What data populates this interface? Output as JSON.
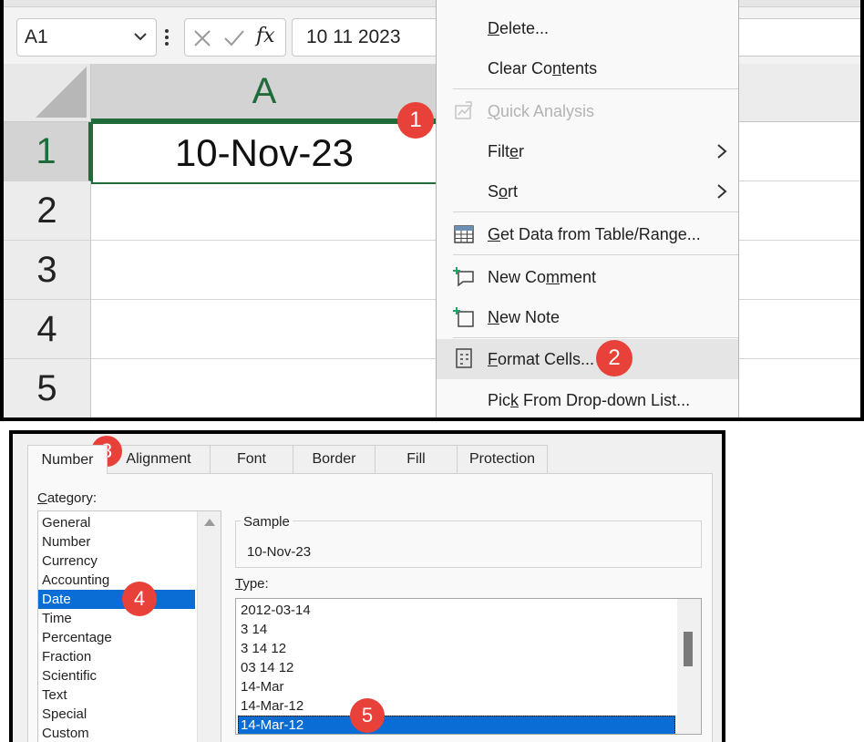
{
  "formula_bar": {
    "name_box": "A1",
    "formula_value": "10 11 2023"
  },
  "sheet": {
    "column_header": "A",
    "row_headers": [
      "1",
      "2",
      "3",
      "4",
      "5"
    ],
    "cell_a1": "10-Nov-23"
  },
  "context_menu": {
    "items": [
      {
        "label": "Delete...",
        "u": "D",
        "pre": "",
        "post": "elete..."
      },
      {
        "label": "Clear Contents",
        "pre": "Clear Co",
        "u": "n",
        "post": "tents"
      },
      {
        "label": "Quick Analysis",
        "pre": "",
        "u": "Q",
        "post": "uick Analysis"
      },
      {
        "label": "Filter",
        "pre": "Filt",
        "u": "e",
        "post": "r"
      },
      {
        "label": "Sort",
        "pre": "S",
        "u": "o",
        "post": "rt"
      },
      {
        "label": "Get Data from Table/Range...",
        "pre": "",
        "u": "G",
        "post": "et Data from Table/Range..."
      },
      {
        "label": "New Comment",
        "pre": "New Co",
        "u": "m",
        "post": "ment"
      },
      {
        "label": "New Note",
        "pre": "",
        "u": "N",
        "post": "ew Note"
      },
      {
        "label": "Format Cells...",
        "pre": "",
        "u": "F",
        "post": "ormat Cells..."
      },
      {
        "label": "Pick From Drop-down List...",
        "pre": "Pic",
        "u": "k",
        "post": " From Drop-down List..."
      }
    ]
  },
  "steps": [
    "1",
    "2",
    "3",
    "4",
    "5"
  ],
  "dialog": {
    "tabs": [
      "Number",
      "Alignment",
      "Font",
      "Border",
      "Fill",
      "Protection"
    ],
    "category_label": "Category:",
    "category_label_u": "C",
    "category_label_rest": "ategory:",
    "categories": [
      "General",
      "Number",
      "Currency",
      "Accounting",
      "Date",
      "Time",
      "Percentage",
      "Fraction",
      "Scientific",
      "Text",
      "Special",
      "Custom"
    ],
    "selected_category": "Date",
    "sample_label": "Sample",
    "sample_value": "10-Nov-23",
    "type_label_u": "T",
    "type_label_rest": "ype:",
    "types": [
      "2012-03-14",
      "3 14",
      "3 14 12",
      "03 14 12",
      "14-Mar",
      "14-Mar-12",
      "14-Mar-12"
    ],
    "selected_type_index": 6
  },
  "colors": {
    "excel_green": "#1f6b3a",
    "badge_red": "#e8413a",
    "selection_blue": "#0a6dd6"
  }
}
